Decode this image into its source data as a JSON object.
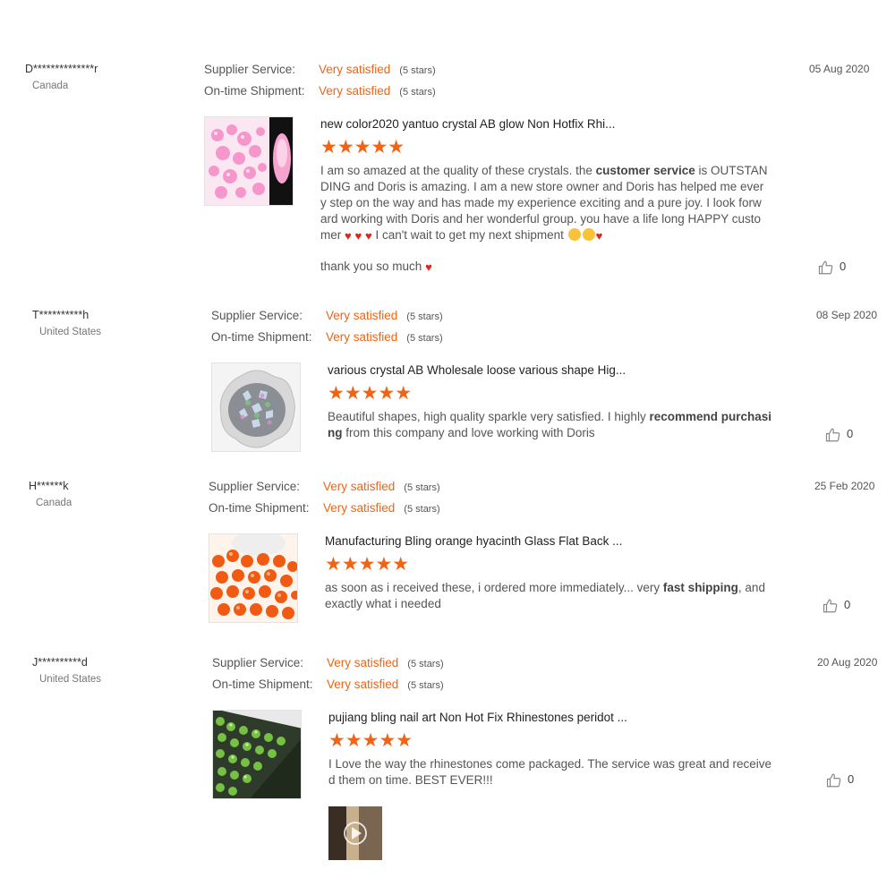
{
  "labels": {
    "supplier_service": "Supplier Service:",
    "on_time_shipment": "On-time Shipment:"
  },
  "colors": {
    "accent": "#f06414",
    "text": "#555555",
    "border": "#e3e3e3"
  },
  "reviews": [
    {
      "reviewer": "D**************r",
      "country": "Canada",
      "supplier_service": "Very satisfied",
      "supplier_stars": "(5 stars)",
      "shipment": "Very satisfied",
      "shipment_stars": "(5 stars)",
      "date": "05 Aug 2020",
      "product_title": "new color2020 yantuo crystal AB glow Non Hotfix Rhi...",
      "rating": 5,
      "text_parts": [
        "I am so amazed at the quality of these crystals.  the ",
        "customer service",
        " is OUTSTANDING and Doris is amazing.  I am a new store owner and Doris has helped me every step on the way and has made my experience exciting and a pure joy.  I look forward working with Doris and her wonderful group.  you have a life long HAPPY customer ",
        " I can't wait to get my next shipment "
      ],
      "extra_text": "thank you so much ",
      "likes": "0",
      "thumb_icon": "pink-crystals-image"
    },
    {
      "reviewer": "T**********h",
      "country": "United States",
      "supplier_service": "Very satisfied",
      "supplier_stars": "(5 stars)",
      "shipment": "Very satisfied",
      "shipment_stars": "(5 stars)",
      "date": "08 Sep 2020",
      "product_title": "various crystal AB Wholesale loose various shape Hig...",
      "rating": 5,
      "text_parts": [
        "Beautiful shapes, high quality sparkle very satisfied. I highly ",
        "recommend purchasing",
        " from this company and love working with Doris"
      ],
      "likes": "0",
      "thumb_icon": "crystal-bowl-image"
    },
    {
      "reviewer": "H******k",
      "country": "Canada",
      "supplier_service": "Very satisfied",
      "supplier_stars": "(5 stars)",
      "shipment": "Very satisfied",
      "shipment_stars": "(5 stars)",
      "date": "25 Feb 2020",
      "product_title": "Manufacturing Bling orange hyacinth Glass Flat Back ...",
      "rating": 5,
      "text_parts": [
        "as soon as i received these, i ordered more immediately... very ",
        "fast shipping",
        ", and exactly what i needed"
      ],
      "likes": "0",
      "thumb_icon": "orange-rhinestones-image"
    },
    {
      "reviewer": "J**********d",
      "country": "United States",
      "supplier_service": "Very satisfied",
      "supplier_stars": "(5 stars)",
      "shipment": "Very satisfied",
      "shipment_stars": "(5 stars)",
      "date": "20 Aug 2020",
      "product_title": "pujiang bling nail art Non Hot Fix Rhinestones peridot ...",
      "rating": 5,
      "text_parts": [
        "I Love the way the rhinestones come packaged. The service was great and received them on time. BEST EVER!!!"
      ],
      "likes": "0",
      "thumb_icon": "green-rhinestones-image",
      "video_icon": "video-play-icon"
    }
  ]
}
